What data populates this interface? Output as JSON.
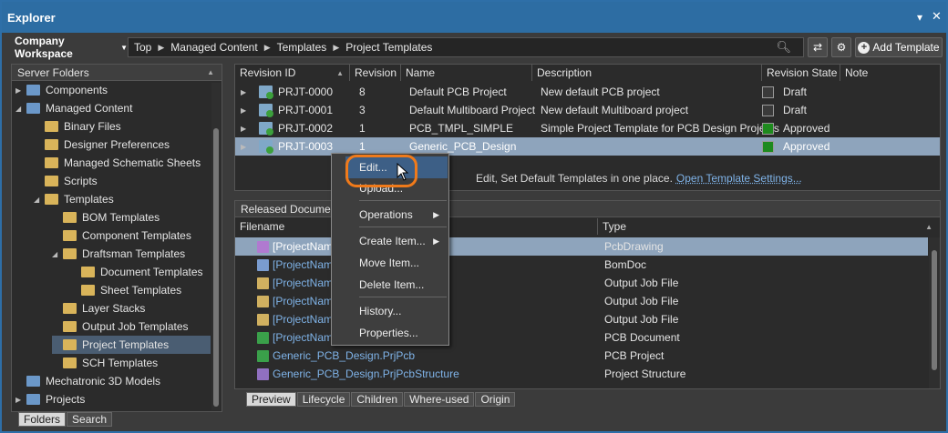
{
  "window": {
    "title": "Explorer"
  },
  "nav": {
    "workspace": "Company Workspace",
    "breadcrumb": [
      "Top",
      "Managed Content",
      "Templates",
      "Project Templates"
    ],
    "add_template": "Add Template"
  },
  "server_folders": {
    "header": "Server Folders",
    "items": [
      {
        "label": "Components",
        "depth": 0,
        "expanded": false
      },
      {
        "label": "Managed Content",
        "depth": 0,
        "expanded": true
      },
      {
        "label": "Binary Files",
        "depth": 1
      },
      {
        "label": "Designer Preferences",
        "depth": 1
      },
      {
        "label": "Managed Schematic Sheets",
        "depth": 1
      },
      {
        "label": "Scripts",
        "depth": 1
      },
      {
        "label": "Templates",
        "depth": 1,
        "expanded": true
      },
      {
        "label": "BOM Templates",
        "depth": 2
      },
      {
        "label": "Component Templates",
        "depth": 2
      },
      {
        "label": "Draftsman Templates",
        "depth": 2,
        "expanded": true
      },
      {
        "label": "Document Templates",
        "depth": 3
      },
      {
        "label": "Sheet Templates",
        "depth": 3
      },
      {
        "label": "Layer Stacks",
        "depth": 2
      },
      {
        "label": "Output Job Templates",
        "depth": 2
      },
      {
        "label": "Project Templates",
        "depth": 2,
        "selected": true
      },
      {
        "label": "SCH Templates",
        "depth": 2
      },
      {
        "label": "Mechatronic 3D Models",
        "depth": 0
      },
      {
        "label": "Projects",
        "depth": 0,
        "expanded": false
      }
    ],
    "tabs": [
      "Folders",
      "Search"
    ]
  },
  "revisions": {
    "columns": [
      "Revision ID",
      "Revision",
      "Name",
      "Description",
      "Revision State",
      "Note"
    ],
    "rows": [
      {
        "id": "PRJT-0000",
        "revision": "8",
        "name": "Default PCB Project",
        "description": "New default PCB project",
        "state": "Draft",
        "state_color": "#3a3a3a"
      },
      {
        "id": "PRJT-0001",
        "revision": "3",
        "name": "Default Multiboard Project",
        "description": "New default Multiboard project",
        "state": "Draft",
        "state_color": "#3a3a3a"
      },
      {
        "id": "PRJT-0002",
        "revision": "1",
        "name": "PCB_TMPL_SIMPLE",
        "description": "Simple Project Template for PCB Design Projects",
        "state": "Approved",
        "state_color": "#1e8a1e"
      },
      {
        "id": "PRJT-0003",
        "revision": "1",
        "name": "Generic_PCB_Design",
        "description": "",
        "state": "Approved",
        "state_color": "#1e8a1e",
        "selected": true
      }
    ],
    "hint_text": "Edit, Set Default Templates in one place.",
    "hint_link": "Open Template Settings..."
  },
  "released_documents": {
    "header": "Released Documents",
    "columns": [
      "Filename",
      "Type"
    ],
    "rows": [
      {
        "filename": "[ProjectNam",
        "type": "PcbDrawing",
        "selected": true
      },
      {
        "filename": "[ProjectNam",
        "type": "BomDoc"
      },
      {
        "filename": "[ProjectNam",
        "type": "Output Job File"
      },
      {
        "filename": "[ProjectNam",
        "type": "Output Job File"
      },
      {
        "filename": "[ProjectNam",
        "type": "Output Job File"
      },
      {
        "filename": "[ProjectNam",
        "type": "PCB Document"
      },
      {
        "filename": "Generic_PCB_Design.PrjPcb",
        "type": "PCB Project"
      },
      {
        "filename": "Generic_PCB_Design.PrjPcbStructure",
        "type": "Project Structure"
      }
    ],
    "tabs": [
      "Preview",
      "Lifecycle",
      "Children",
      "Where-used",
      "Origin"
    ]
  },
  "context_menu": {
    "items": [
      "Edit...",
      "Upload...",
      "Operations",
      "Create Item...",
      "Move Item...",
      "Delete Item...",
      "History...",
      "Properties..."
    ]
  }
}
